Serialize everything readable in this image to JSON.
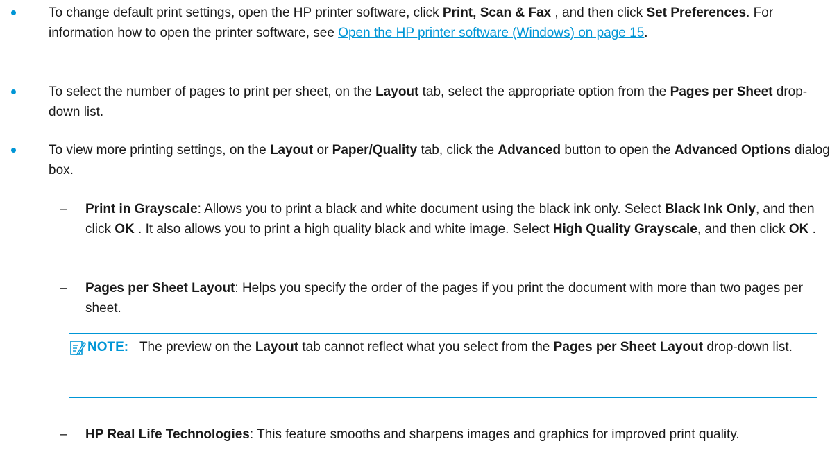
{
  "bullets": [
    {
      "parts": [
        {
          "t": "To change default print settings, open the HP printer software, click "
        },
        {
          "t": "Print, Scan & Fax",
          "b": true
        },
        {
          "t": " , and then click "
        },
        {
          "t": "Set Preferences",
          "b": true
        },
        {
          "t": ". For information how to open the printer software, see "
        },
        {
          "t": "Open the HP printer software (Windows) on page 15",
          "link": true
        },
        {
          "t": "."
        }
      ]
    },
    {
      "parts": [
        {
          "t": "To select the number of pages to print per sheet, on the "
        },
        {
          "t": "Layout",
          "b": true
        },
        {
          "t": " tab, select the appropriate option from the "
        },
        {
          "t": "Pages per Sheet",
          "b": true
        },
        {
          "t": " drop-down list."
        }
      ]
    },
    {
      "parts": [
        {
          "t": "To view more printing settings, on the "
        },
        {
          "t": "Layout",
          "b": true
        },
        {
          "t": " or "
        },
        {
          "t": "Paper/Quality",
          "b": true
        },
        {
          "t": " tab, click the "
        },
        {
          "t": "Advanced",
          "b": true
        },
        {
          "t": " button to open the "
        },
        {
          "t": "Advanced Options",
          "b": true
        },
        {
          "t": " dialog box."
        }
      ]
    }
  ],
  "sub_items": [
    {
      "parts": [
        {
          "t": "Print in Grayscale",
          "b": true
        },
        {
          "t": ": Allows you to print a black and white document using the black ink only. Select "
        },
        {
          "t": "Black Ink Only",
          "b": true
        },
        {
          "t": ", and then click "
        },
        {
          "t": "OK",
          "b": true
        },
        {
          "t": " . It also allows you to print a high quality black and white image. Select "
        },
        {
          "t": "High Quality Grayscale",
          "b": true
        },
        {
          "t": ", and then click "
        },
        {
          "t": "OK",
          "b": true
        },
        {
          "t": " ."
        }
      ]
    },
    {
      "parts": [
        {
          "t": "Pages per Sheet Layout",
          "b": true
        },
        {
          "t": ": Helps you specify the order of the pages if you print the document with more than two pages per sheet."
        }
      ]
    },
    {
      "parts": [
        {
          "t": "HP Real Life Technologies",
          "b": true
        },
        {
          "t": ": This feature smooths and sharpens images and graphics for improved print quality."
        }
      ]
    }
  ],
  "note": {
    "label": "NOTE:",
    "parts": [
      {
        "t": "The preview on the "
      },
      {
        "t": "Layout",
        "b": true
      },
      {
        "t": " tab cannot reflect what you select from the "
      },
      {
        "t": "Pages per Sheet Layout",
        "b": true
      },
      {
        "t": " drop-down list."
      }
    ]
  },
  "dash_glyph": "–",
  "accent_color": "#0096d6"
}
